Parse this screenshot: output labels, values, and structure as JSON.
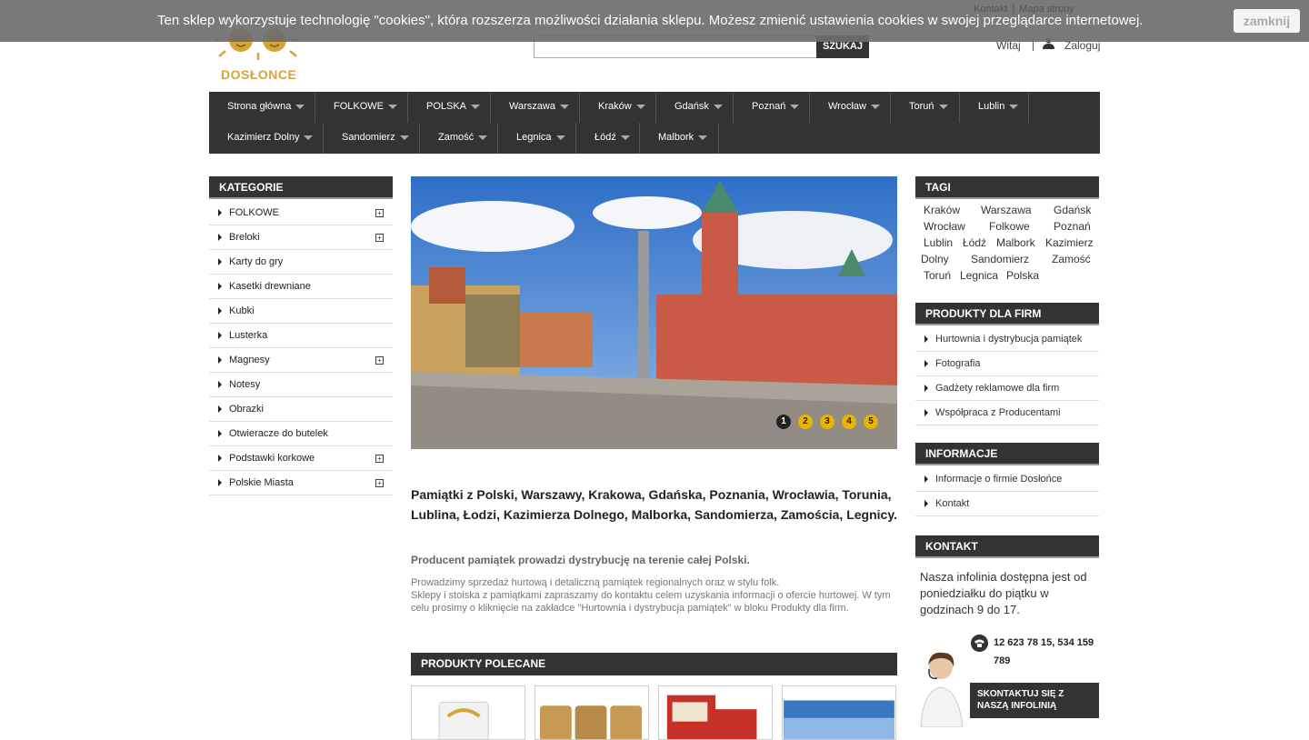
{
  "cookie": {
    "text": "Ten sklep wykorzystuje technologię \"cookies\", która rozszerza możliwości działania sklepu. Możesz zmienić ustawienia cookies w swojej przeglądarce internetowej.",
    "close_label": "zamknij"
  },
  "top_links": {
    "contact": "Kontakt",
    "sitemap": "Mapa strony",
    "separator": "|"
  },
  "logo": {
    "text": "DOSŁONCE"
  },
  "search": {
    "placeholder": "",
    "button_label": "SZUKAJ"
  },
  "account": {
    "welcome": "Witaj",
    "login": "Zaloguj"
  },
  "nav": {
    "row1": [
      "Strona główna",
      "FOLKOWE",
      "POLSKA",
      "Warszawa",
      "Kraków",
      "Gdańsk",
      "Poznań",
      "Wrocław",
      "Toruń",
      "Lublin"
    ],
    "row2": [
      "Kazimierz Dolny",
      "Sandomierz",
      "Zamość",
      "Legnica",
      "Łódź",
      "Malbork"
    ]
  },
  "categories": {
    "title": "KATEGORIE",
    "items": [
      {
        "label": "FOLKOWE",
        "expandable": true
      },
      {
        "label": "Breloki",
        "expandable": true
      },
      {
        "label": "Karty do gry",
        "expandable": false
      },
      {
        "label": "Kasetki drewniane",
        "expandable": false
      },
      {
        "label": "Kubki",
        "expandable": false
      },
      {
        "label": "Lusterka",
        "expandable": false
      },
      {
        "label": "Magnesy",
        "expandable": true
      },
      {
        "label": "Notesy",
        "expandable": false
      },
      {
        "label": "Obrazki",
        "expandable": false
      },
      {
        "label": "Otwieracze do butelek",
        "expandable": false
      },
      {
        "label": "Podstawki korkowe",
        "expandable": true
      },
      {
        "label": "Polskie Miasta",
        "expandable": true
      }
    ]
  },
  "slider": {
    "dots": [
      "1",
      "2",
      "3",
      "4",
      "5"
    ],
    "active": 1
  },
  "main": {
    "title": "Pamiątki z Polski, Warszawy, Krakowa, Gdańska, Poznania, Wrocławia, Torunia, Lublina, Łodzi, Kazimierza Dolnego, Malborka, Sandomierza, Zamościa, Legnicy.",
    "subtitle": "Producent pamiątek prowadzi dystrybucję na terenie całej Polski.",
    "body1": "Prowadzimy sprzedaż hurtową i detaliczną pamiątek regionalnych oraz w stylu folk.",
    "body2": "Sklepy i stoiska z pamiątkami zapraszamy do kontaktu celem uzyskania informacji o ofercie hurtowej. W tym celu prosimy o kliknięcie na zakładce \"Hurtownia i dystrybucja pamiątek\" w bloku Produkty dla firm."
  },
  "featured": {
    "title": "PRODUKTY POLECANE"
  },
  "tags": {
    "title": "TAGI",
    "lines": [
      [
        "Kraków",
        "Warszawa",
        "Gdańsk"
      ],
      [
        "Wrocław",
        "Folkowe",
        "Poznań"
      ],
      [
        "Lublin",
        "Łódź",
        "Malbork",
        "Kazimierz"
      ],
      [
        "Dolny",
        "Sandomierz",
        "Zamość"
      ],
      [
        "Toruń",
        "Legnica",
        "Polska"
      ]
    ]
  },
  "business": {
    "title": "PRODUKTY DLA FIRM",
    "items": [
      "Hurtownia i dystrybucja pamiątek",
      "Fotografia",
      "Gadżety reklamowe dla firm",
      "Współpraca z Producentami"
    ]
  },
  "info": {
    "title": "INFORMACJE",
    "items": [
      "Informacje o firmie Dosłońce",
      "Kontakt"
    ]
  },
  "contact": {
    "title": "KONTAKT",
    "text": "Nasza infolinia dostępna jest od poniedziałku do piątku w godzinach 9 do 17.",
    "phone": "12 623 78 15, 534 159 789",
    "button": "SKONTAKTUJ SIĘ Z NASZĄ INFOLINIĄ"
  },
  "colors": {
    "dark": "#333333",
    "accent_gold": "#d6a437",
    "slider_dot": "#e8b400"
  }
}
